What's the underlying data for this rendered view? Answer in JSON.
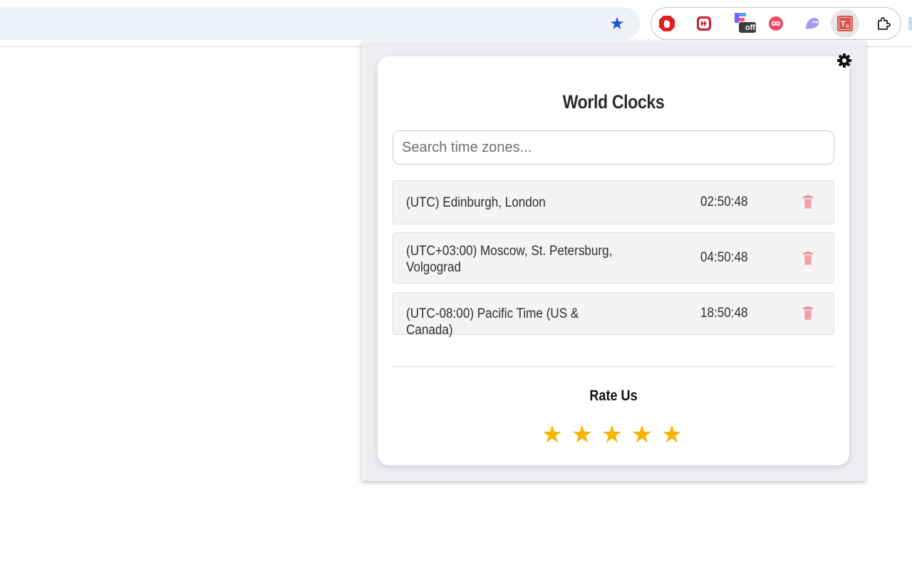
{
  "toolbar": {
    "bookmark_icon": "star-filled-icon",
    "extensions": [
      {
        "name": "adblock-icon",
        "color": "#e0201b"
      },
      {
        "name": "video-speed-icon",
        "color": "#d21b2a"
      },
      {
        "name": "off-extension-icon",
        "badge": "off"
      },
      {
        "name": "infinity-icon",
        "color": "#f14a6a"
      },
      {
        "name": "ghost-icon",
        "color": "#9d8cf0"
      },
      {
        "name": "translate-ext-icon",
        "color": "#d4574f"
      },
      {
        "name": "puzzle-icon"
      }
    ]
  },
  "popup": {
    "title": "World Clocks",
    "search": {
      "placeholder": "Search time zones...",
      "value": ""
    },
    "clocks": [
      {
        "name": "(UTC) Edinburgh, London",
        "time": "02:50:48"
      },
      {
        "name": "(UTC+03:00) Moscow, St. Petersburg, Volgograd",
        "time": "04:50:48"
      },
      {
        "name": "(UTC-08:00) Pacific Time (US & Canada)",
        "time": "18:50:48"
      }
    ],
    "rate": {
      "title": "Rate Us",
      "stars": 5,
      "star_glyph": "★",
      "star_color": "#f7b500"
    },
    "delete_icon_color": "#f08a9a"
  }
}
